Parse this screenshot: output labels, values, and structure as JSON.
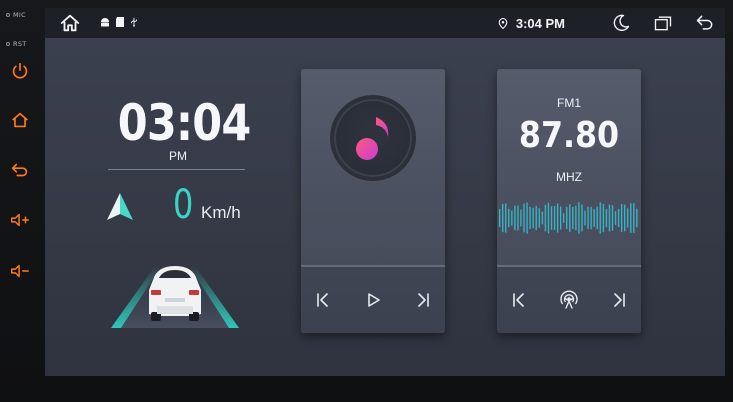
{
  "hardware": {
    "mic_label": "MIC",
    "rst_label": "RST",
    "keys": [
      "power-icon",
      "home-icon",
      "back-icon",
      "volume-up-icon",
      "volume-down-icon"
    ],
    "key_color": "#ff7a1a"
  },
  "status_bar": {
    "home_icon": "home-icon",
    "system_icons": [
      "android-icon",
      "sd-card-icon",
      "usb-icon"
    ],
    "location_icon": "location-pin-icon",
    "time": "3:04 PM",
    "right_icons": [
      "night-mode-icon",
      "recent-apps-icon",
      "back-icon"
    ]
  },
  "clock": {
    "time": "03:04",
    "ampm": "PM"
  },
  "speed": {
    "value": "0",
    "unit": "Km/h",
    "accent": "#37d6c4"
  },
  "music": {
    "icon": "music-note-icon",
    "controls": [
      "previous-icon",
      "play-icon",
      "next-icon"
    ],
    "accent_from": "#ff5a7a",
    "accent_to": "#c83cd6"
  },
  "radio": {
    "band": "FM1",
    "frequency": "87.80",
    "unit": "MHZ",
    "controls": [
      "previous-icon",
      "radio-signal-icon",
      "next-icon"
    ],
    "wave_from": "#2ed4a6",
    "wave_to": "#3f8fe0"
  }
}
